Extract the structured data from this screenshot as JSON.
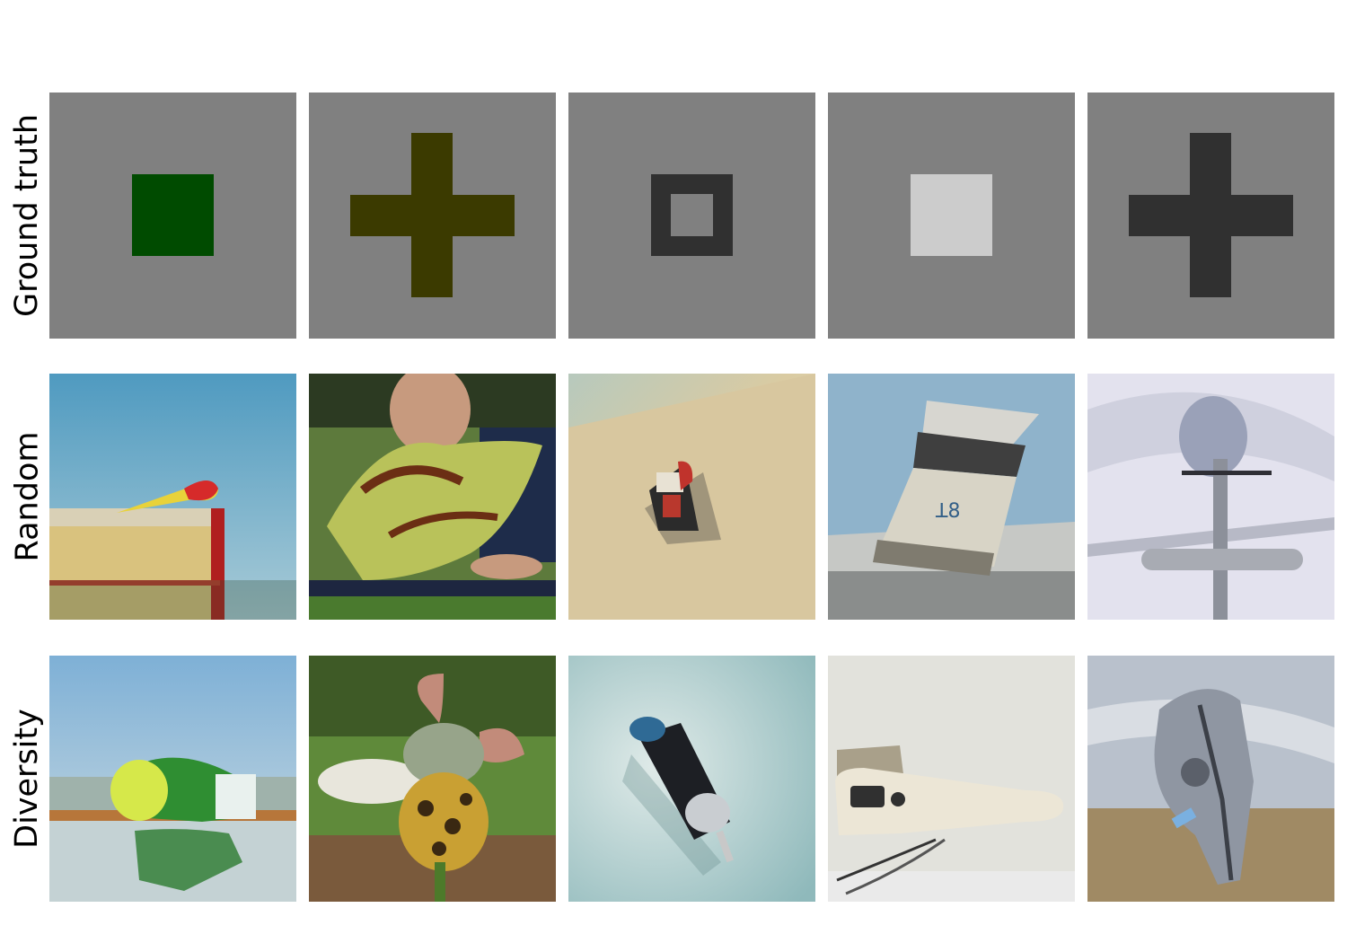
{
  "rows": [
    {
      "label": "Ground truth"
    },
    {
      "label": "Random"
    },
    {
      "label": "Diversity"
    }
  ],
  "ground_truth": [
    {
      "shape": "square",
      "color": "#004b00"
    },
    {
      "shape": "plus",
      "color": "#3b3a00"
    },
    {
      "shape": "hollow-square",
      "color": "#303030"
    },
    {
      "shape": "square",
      "color": "#cccccc"
    },
    {
      "shape": "plus",
      "color": "#303030"
    }
  ],
  "random_images": [
    {
      "subject": "red-yellow-toy-rocket-on-box"
    },
    {
      "subject": "green-winged-creature-toy-held-by-man"
    },
    {
      "subject": "red-toy-chair-on-table"
    },
    {
      "subject": "grey-white-cylinder-device"
    },
    {
      "subject": "grey-t-shaped-pole-object"
    }
  ],
  "diversity_images": [
    {
      "subject": "green-bottle-toy-on-reflective-surface"
    },
    {
      "subject": "spotted-animal-toy-in-garden"
    },
    {
      "subject": "black-silver-gadget-on-teal"
    },
    {
      "subject": "white-hair-iron-device"
    },
    {
      "subject": "grey-mechanical-device-hanging"
    }
  ]
}
